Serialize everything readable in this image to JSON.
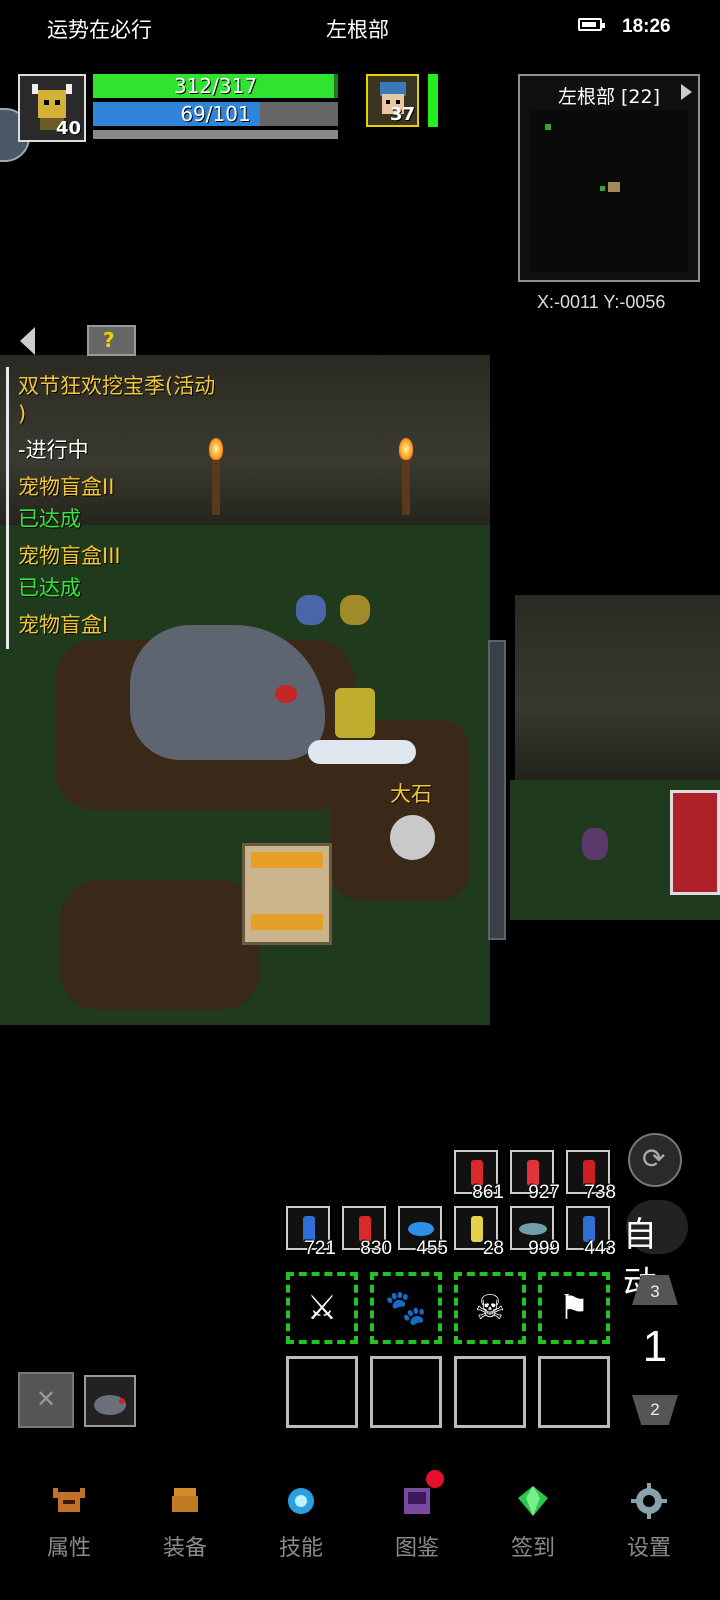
{
  "status_bar": {
    "left_text": "运势在必行",
    "center_text": "左根部",
    "time": "18:26"
  },
  "player": {
    "level": "40",
    "hp_text": "312/317",
    "hp_fraction": 0.984,
    "mp_text": "69/101",
    "mp_fraction": 0.683
  },
  "pet": {
    "level": "37",
    "name": "大石"
  },
  "minimap": {
    "title": "左根部 [22]",
    "coords": "X:-0011  Y:-0056"
  },
  "quests": [
    {
      "text": "双节狂欢挖宝季(活动",
      "color": "yellow"
    },
    {
      "text": ")",
      "color": "yellow"
    },
    {
      "text": "-进行中",
      "color": "white"
    },
    {
      "text": "宠物盲盒II",
      "color": "yellow"
    },
    {
      "text": "已达成",
      "color": "green"
    },
    {
      "text": "宠物盲盒III",
      "color": "yellow"
    },
    {
      "text": "已达成",
      "color": "green"
    },
    {
      "text": "宠物盲盒I",
      "color": "yellow"
    }
  ],
  "consumables_row1": [
    {
      "count": "861",
      "icon": "red-potion-icon",
      "color": "#d82a2a"
    },
    {
      "count": "927",
      "icon": "red-potion-icon",
      "color": "#e0343a"
    },
    {
      "count": "738",
      "icon": "red-potion-icon",
      "color": "#cc2020"
    }
  ],
  "consumables_row2": [
    {
      "count": "721",
      "icon": "blue-potion-icon",
      "color": "#2f6fd6"
    },
    {
      "count": "830",
      "icon": "red-potion-icon",
      "color": "#d82a2a"
    },
    {
      "count": "455",
      "icon": "blue-fish-icon",
      "color": "#2f8fe6"
    },
    {
      "count": "28",
      "icon": "scroll-icon",
      "color": "#e6d24a"
    },
    {
      "count": "999",
      "icon": "fish-icon",
      "color": "#6fa0a8"
    },
    {
      "count": "443",
      "icon": "blue-potion-icon",
      "color": "#2f6fd6"
    }
  ],
  "auto_label": "自动",
  "skill_page": {
    "current": "1",
    "up": "3",
    "down": "2"
  },
  "skills": [
    {
      "icon": "slash-skill-icon",
      "glyph": "⚔"
    },
    {
      "icon": "beast-skill-icon",
      "glyph": "🐾"
    },
    {
      "icon": "demon-skill-icon",
      "glyph": "☠"
    },
    {
      "icon": "knight-skill-icon",
      "glyph": "⚑"
    }
  ],
  "nav": [
    {
      "label": "属性",
      "icon": "helmet-icon",
      "color": "#c2702a"
    },
    {
      "label": "装备",
      "icon": "armor-icon",
      "color": "#d48a2a"
    },
    {
      "label": "技能",
      "icon": "skill-gem-icon",
      "color": "#2aa0e0"
    },
    {
      "label": "图鉴",
      "icon": "book-icon",
      "color": "#7a4aa0"
    },
    {
      "label": "签到",
      "icon": "emerald-icon",
      "color": "#2ac84a"
    },
    {
      "label": "设置",
      "icon": "gear-icon",
      "color": "#8aa0aa"
    }
  ]
}
